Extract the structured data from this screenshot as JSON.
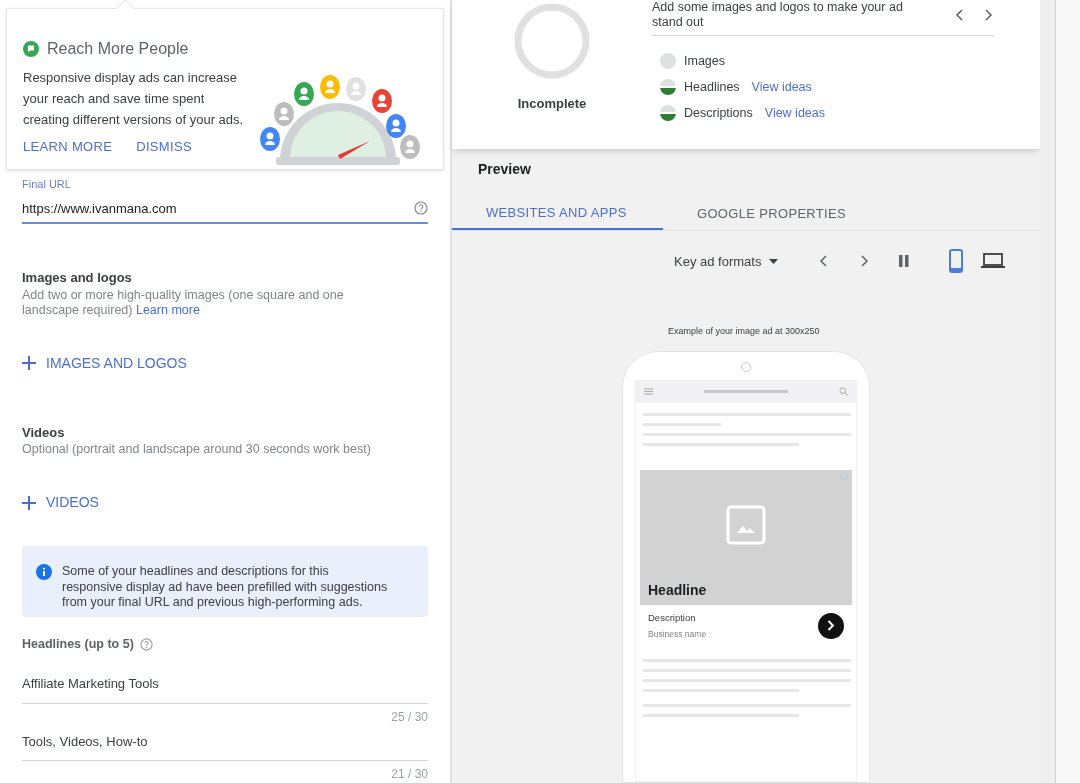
{
  "tip": {
    "title": "Reach More People",
    "body": "Responsive display ads can increase your reach and save time spent creating different versions of your ads.",
    "actions": [
      "LEARN MORE",
      "DISMISS"
    ]
  },
  "final_url": {
    "label": "Final URL",
    "value": "https://www.ivanmana.com"
  },
  "images_section": {
    "title": "Images and logos",
    "description": "Add two or more high-quality images (one square and one landscape required)",
    "link": "Learn more",
    "add_button": "IMAGES AND LOGOS"
  },
  "videos_section": {
    "title": "Videos",
    "description": "Optional (portrait and landscape around 30 seconds work best)",
    "add_button": "VIDEOS"
  },
  "info_banner": {
    "text": "Some of your headlines and descriptions for this responsive display ad have been prefilled with suggestions from your final URL and previous high-performing ads."
  },
  "headlines": {
    "title": "Headlines (up to 5)",
    "items": [
      {
        "value": "Affiliate Marketing Tools",
        "counter": "25 / 30"
      },
      {
        "value": "Tools, Videos, How-to",
        "counter": "21 / 30"
      }
    ]
  },
  "ad_strength": {
    "status": "Incomplete",
    "message": "Add some images and logos to make your ad stand out",
    "checklist": [
      {
        "label": "Images",
        "started": false
      },
      {
        "label": "Headlines",
        "started": true,
        "link": "View ideas"
      },
      {
        "label": "Descriptions",
        "started": true,
        "link": "View ideas"
      }
    ]
  },
  "preview": {
    "title": "Preview",
    "tabs": [
      {
        "label": "WEBSITES AND APPS",
        "selected": true
      },
      {
        "label": "GOOGLE PROPERTIES",
        "selected": false
      }
    ],
    "format_dropdown": "Key ad formats",
    "devices": [
      {
        "kind": "mobile",
        "selected": true
      },
      {
        "kind": "desktop",
        "selected": false
      }
    ],
    "caption": "Example of your image ad at 300x250",
    "ad": {
      "headline": "Headline",
      "description": "Description",
      "business_name": "Business name"
    }
  }
}
